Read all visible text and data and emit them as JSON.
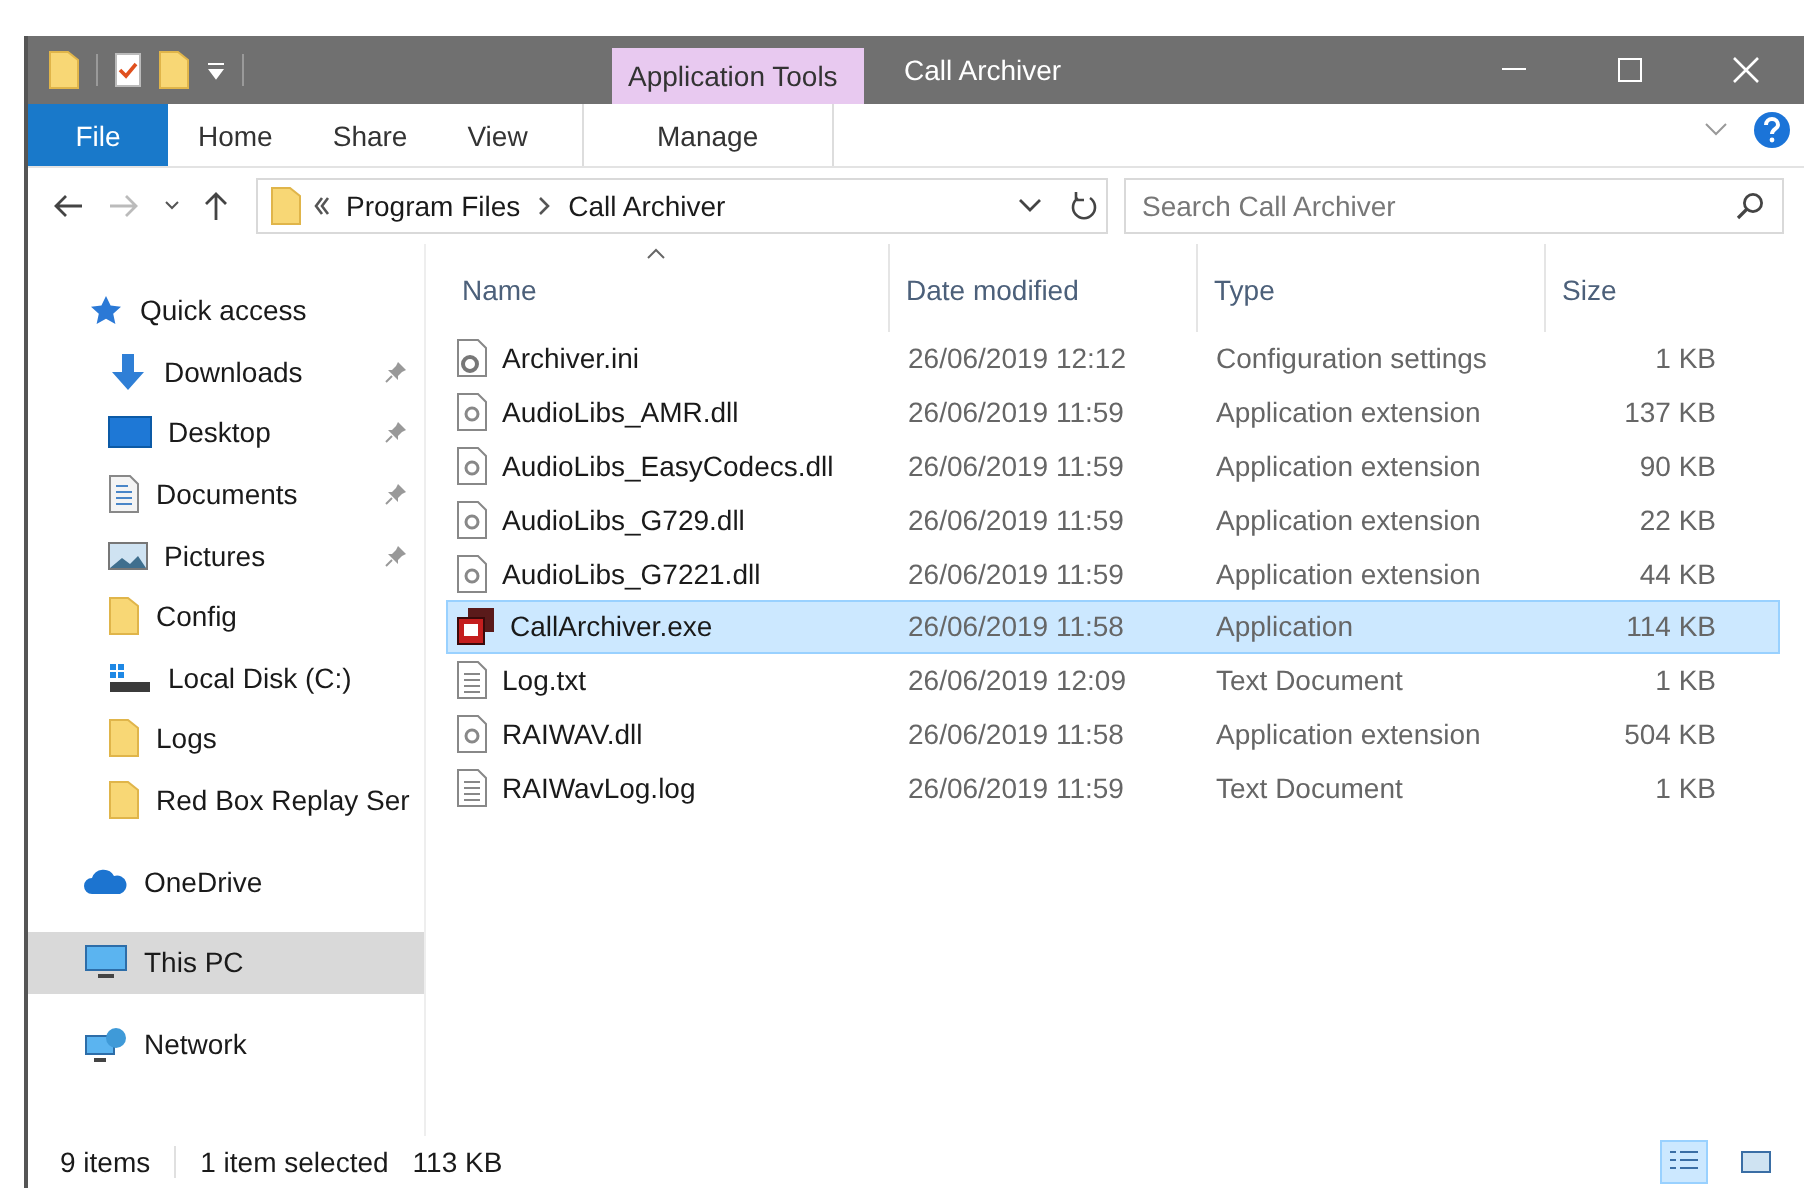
{
  "window": {
    "title": "Call Archiver",
    "context_tab": "Application Tools"
  },
  "ribbon_tabs": [
    {
      "label": "File",
      "kind": "file"
    },
    {
      "label": "Home",
      "kind": "normal"
    },
    {
      "label": "Share",
      "kind": "normal"
    },
    {
      "label": "View",
      "kind": "normal"
    },
    {
      "label": "Manage",
      "kind": "contextual"
    }
  ],
  "nav": {
    "back_disabled": false,
    "forward_disabled": true
  },
  "address": {
    "path": [
      "Program Files",
      "Call Archiver"
    ]
  },
  "search": {
    "placeholder": "Search Call Archiver"
  },
  "sidebar": {
    "items": [
      {
        "label": "Quick access",
        "kind": "star",
        "selected": false,
        "children": [
          {
            "label": "Downloads",
            "kind": "download",
            "pinned": true,
            "selected": false
          },
          {
            "label": "Desktop",
            "kind": "desktop",
            "pinned": true,
            "selected": false
          },
          {
            "label": "Documents",
            "kind": "document",
            "pinned": true,
            "selected": false
          },
          {
            "label": "Pictures",
            "kind": "pictures",
            "pinned": true,
            "selected": false
          },
          {
            "label": "Config",
            "kind": "folder",
            "pinned": false,
            "selected": false
          },
          {
            "label": "Local Disk (C:)",
            "kind": "drive",
            "pinned": false,
            "selected": false
          },
          {
            "label": "Logs",
            "kind": "folder",
            "pinned": false,
            "selected": false
          },
          {
            "label": "Red Box Replay Ser",
            "kind": "folder",
            "pinned": false,
            "selected": false
          }
        ]
      },
      {
        "label": "OneDrive",
        "kind": "cloud",
        "selected": false
      },
      {
        "label": "This PC",
        "kind": "pc",
        "selected": true
      },
      {
        "label": "Network",
        "kind": "network",
        "selected": false
      }
    ]
  },
  "table": {
    "columns": [
      {
        "label": "Name",
        "sorted": true
      },
      {
        "label": "Date modified",
        "sorted": false
      },
      {
        "label": "Type",
        "sorted": false
      },
      {
        "label": "Size",
        "sorted": false
      }
    ],
    "rows": [
      {
        "name": "Archiver.ini",
        "kind": "settings",
        "date": "26/06/2019 12:12",
        "type": "Configuration settings",
        "size": "1 KB",
        "selected": false
      },
      {
        "name": "AudioLibs_AMR.dll",
        "kind": "dll",
        "date": "26/06/2019 11:59",
        "type": "Application extension",
        "size": "137 KB",
        "selected": false
      },
      {
        "name": "AudioLibs_EasyCodecs.dll",
        "kind": "dll",
        "date": "26/06/2019 11:59",
        "type": "Application extension",
        "size": "90 KB",
        "selected": false
      },
      {
        "name": "AudioLibs_G729.dll",
        "kind": "dll",
        "date": "26/06/2019 11:59",
        "type": "Application extension",
        "size": "22 KB",
        "selected": false
      },
      {
        "name": "AudioLibs_G7221.dll",
        "kind": "dll",
        "date": "26/06/2019 11:59",
        "type": "Application extension",
        "size": "44 KB",
        "selected": false
      },
      {
        "name": "CallArchiver.exe",
        "kind": "exe",
        "date": "26/06/2019 11:58",
        "type": "Application",
        "size": "114 KB",
        "selected": true
      },
      {
        "name": "Log.txt",
        "kind": "text",
        "date": "26/06/2019 12:09",
        "type": "Text Document",
        "size": "1 KB",
        "selected": false
      },
      {
        "name": "RAIWAV.dll",
        "kind": "dll",
        "date": "26/06/2019 11:58",
        "type": "Application extension",
        "size": "504 KB",
        "selected": false
      },
      {
        "name": "RAIWavLog.log",
        "kind": "text",
        "date": "26/06/2019 11:59",
        "type": "Text Document",
        "size": "1 KB",
        "selected": false
      }
    ]
  },
  "status_bar": {
    "count": "9 items",
    "selection": "1 item selected",
    "size": "113 KB",
    "views": [
      {
        "kind": "details",
        "selected": true
      },
      {
        "kind": "large",
        "selected": false
      }
    ]
  }
}
